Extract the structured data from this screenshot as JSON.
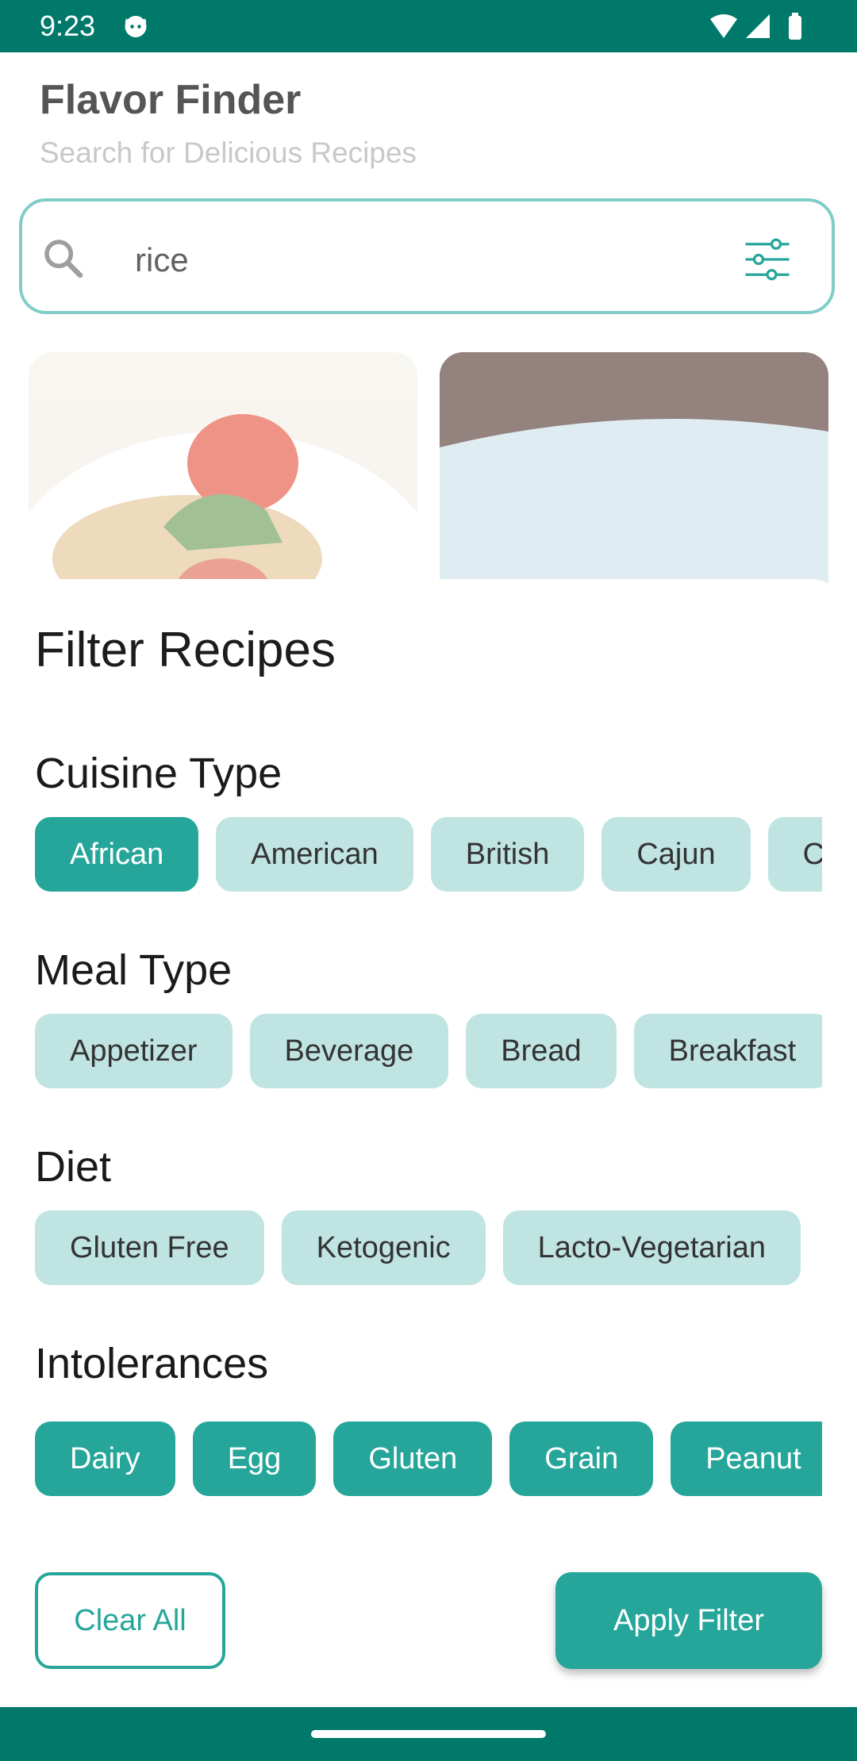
{
  "status_bar": {
    "time": "9:23"
  },
  "header": {
    "title": "Flavor Finder",
    "subtitle": "Search for Delicious Recipes"
  },
  "search": {
    "value": "rice"
  },
  "sheet": {
    "title": "Filter Recipes",
    "sections": [
      {
        "title": "Cuisine Type",
        "chips": [
          {
            "label": "African",
            "selected": true
          },
          {
            "label": "American",
            "selected": false
          },
          {
            "label": "British",
            "selected": false
          },
          {
            "label": "Cajun",
            "selected": false
          },
          {
            "label": "C",
            "selected": false
          }
        ]
      },
      {
        "title": "Meal Type",
        "chips": [
          {
            "label": "Appetizer",
            "selected": false
          },
          {
            "label": "Beverage",
            "selected": false
          },
          {
            "label": "Bread",
            "selected": false
          },
          {
            "label": "Breakfast",
            "selected": false
          }
        ]
      },
      {
        "title": "Diet",
        "chips": [
          {
            "label": "Gluten Free",
            "selected": false
          },
          {
            "label": "Ketogenic",
            "selected": false
          },
          {
            "label": "Lacto-Vegetarian",
            "selected": false
          }
        ]
      },
      {
        "title": "Intolerances",
        "chips": [
          {
            "label": "Dairy",
            "selected": true
          },
          {
            "label": "Egg",
            "selected": true
          },
          {
            "label": "Gluten",
            "selected": true
          },
          {
            "label": "Grain",
            "selected": true
          },
          {
            "label": "Peanut",
            "selected": true
          }
        ]
      }
    ],
    "clear_label": "Clear All",
    "apply_label": "Apply Filter"
  },
  "colors": {
    "accent": "#26a69a",
    "chip_unselected": "#bfe4e1",
    "status_bar": "#00796b"
  }
}
